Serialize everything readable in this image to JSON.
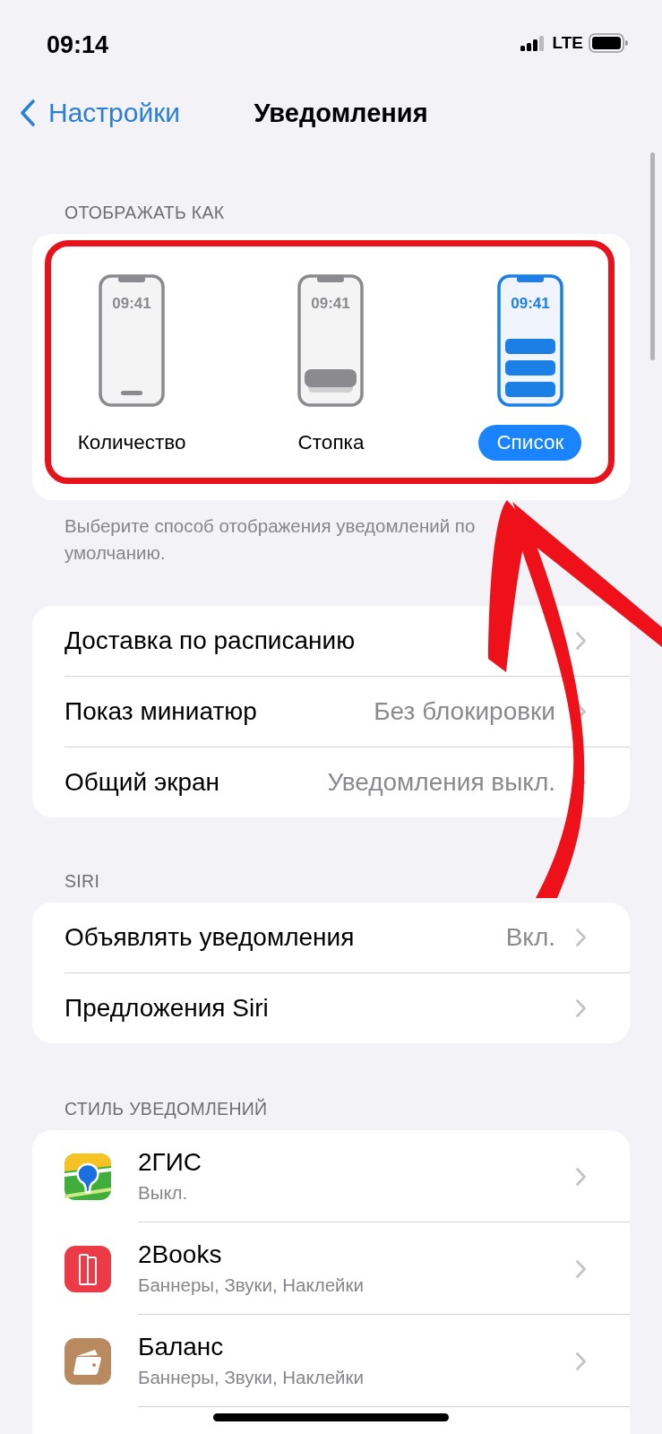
{
  "status_bar": {
    "time": "09:14",
    "network": "LTE"
  },
  "nav_bar": {
    "back": "Настройки",
    "title": "Уведомления"
  },
  "display_as": {
    "header": "ОТОБРАЖАТЬ КАК",
    "footer": "Выберите способ отображения уведомлений по умолчанию.",
    "options": [
      {
        "kind": "count",
        "screen_time": "09:41",
        "label": "Количество",
        "selected": false
      },
      {
        "kind": "stack",
        "screen_time": "09:41",
        "label": "Стопка",
        "selected": false
      },
      {
        "kind": "list",
        "screen_time": "09:41",
        "label": "Список",
        "selected": true
      }
    ]
  },
  "general": {
    "rows": [
      {
        "label": "Доставка по расписанию"
      },
      {
        "label": "Показ миниатюр",
        "value": "Без блокировки"
      },
      {
        "label": "Общий экран",
        "value": "Уведомления выкл."
      }
    ]
  },
  "siri": {
    "header": "SIRI",
    "rows": [
      {
        "label": "Объявлять уведомления",
        "value": "Вкл."
      },
      {
        "label": "Предложения Siri"
      }
    ]
  },
  "notification_style": {
    "header": "СТИЛЬ УВЕДОМЛЕНИЙ",
    "apps": [
      {
        "kind": "maps",
        "name": "2ГИС",
        "subtitle": "Выкл."
      },
      {
        "kind": "reader",
        "name": "2Books",
        "subtitle": "Баннеры, Звуки, Наклейки"
      },
      {
        "kind": "finance",
        "name": "Баланс",
        "subtitle": "Баннеры, Звуки, Наклейки"
      }
    ]
  }
}
